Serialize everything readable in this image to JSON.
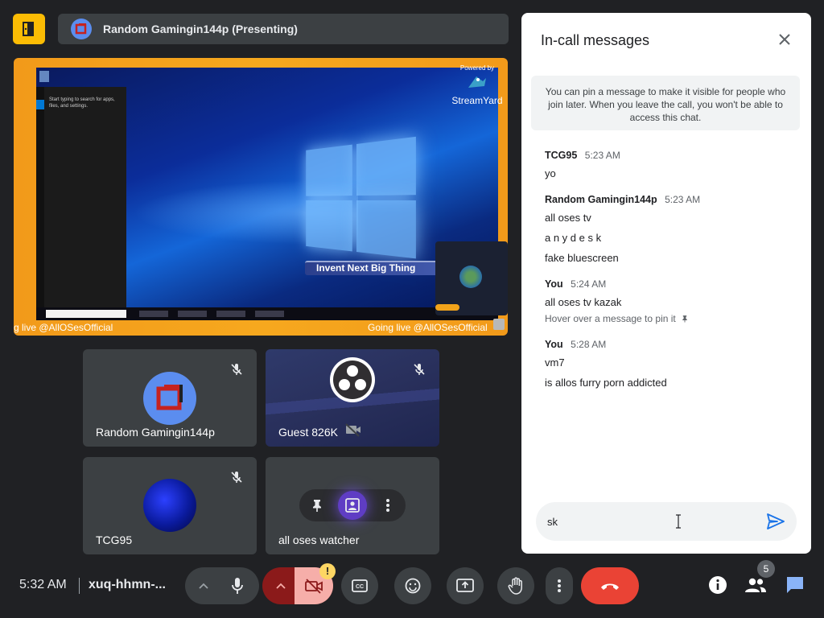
{
  "presenter": {
    "name": "Random Gamingin144p (Presenting)"
  },
  "stage": {
    "ticker_text": "Invent Next Big Thing",
    "powered_by": "Powered by",
    "brand": "StreamYard",
    "going_live_left": "g live @AllOSesOfficial",
    "going_live_right": "Going live @AllOSesOfficial",
    "start_menu_text": "Start typing to search for apps, files, and settings."
  },
  "tiles": [
    {
      "name": "Random Gamingin144p",
      "muted": true
    },
    {
      "name": "Guest 826K",
      "muted": true,
      "camera_off": true
    },
    {
      "name": "TCG95",
      "muted": true
    },
    {
      "name": "all oses watcher",
      "muted": false
    }
  ],
  "chat": {
    "title": "In-call messages",
    "pin_note": "You can pin a message to make it visible for people who join later. When you leave the call, you won't be able to access this chat.",
    "messages": [
      {
        "sender": "TCG95",
        "time": "5:23 AM",
        "lines": [
          "yo"
        ]
      },
      {
        "sender": "Random Gamingin144p",
        "time": "5:23 AM",
        "lines": [
          "all oses tv",
          "a n y d e s k",
          "fake bluescreen"
        ]
      },
      {
        "sender": "You",
        "time": "5:24 AM",
        "lines": [
          "all oses tv kazak"
        ],
        "hint": "Hover over a message to pin it"
      },
      {
        "sender": "You",
        "time": "5:28 AM",
        "lines": [
          "vm7",
          "is allos furry porn addicted"
        ]
      }
    ],
    "input_value": "sk"
  },
  "bottom": {
    "clock": "5:32 AM",
    "meeting_code": "xuq-hhmn-...",
    "camera_warning": "!",
    "participant_count": "5"
  },
  "colors": {
    "accent_yellow": "#fbbc04",
    "end_call_red": "#ea4335",
    "camera_off_bg": "#f6aea9",
    "chat_blue": "#8ab4f8",
    "send_blue": "#1a73e8"
  }
}
